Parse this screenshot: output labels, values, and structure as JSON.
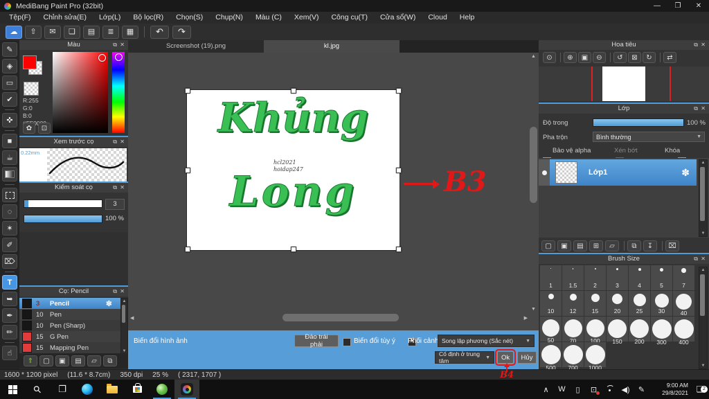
{
  "window": {
    "title": "MediBang Paint Pro (32bit)",
    "controls": {
      "minimize": "—",
      "maximize": "❐",
      "close": "✕"
    }
  },
  "menu": {
    "items": [
      "Tệp(F)",
      "Chỉnh sửa(E)",
      "Lớp(L)",
      "Bộ lọc(R)",
      "Chọn(S)",
      "Chụp(N)",
      "Màu (C)",
      "Xem(V)",
      "Công cụ(T)",
      "Cửa sổ(W)",
      "Cloud",
      "Help"
    ]
  },
  "toolbar": {
    "items": [
      {
        "name": "cloud-sync-icon",
        "glyph": "☁",
        "active": true
      },
      {
        "name": "export-icon",
        "glyph": "⇧"
      },
      {
        "name": "cloud-message-icon",
        "glyph": "✉"
      },
      {
        "name": "comment-icon",
        "glyph": "❏"
      },
      {
        "name": "document-icon",
        "glyph": "▤"
      },
      {
        "name": "material-list-icon",
        "glyph": "≣"
      },
      {
        "name": "panel-layout-icon",
        "glyph": "▦"
      }
    ],
    "history": [
      {
        "name": "undo-icon",
        "glyph": "↶"
      },
      {
        "name": "redo-icon",
        "glyph": "↷"
      }
    ]
  },
  "tools": {
    "items": [
      {
        "name": "tool-brush",
        "glyph": "✎"
      },
      {
        "name": "tool-eraser",
        "glyph": "◈"
      },
      {
        "name": "tool-shape",
        "glyph": "▭"
      },
      {
        "name": "tool-control-point",
        "glyph": "✔"
      },
      {
        "divider": true
      },
      {
        "name": "tool-move",
        "glyph": "✜"
      },
      {
        "divider": true
      },
      {
        "name": "tool-fill-rect",
        "glyph": "■"
      },
      {
        "name": "tool-bucket",
        "glyph": "☕"
      },
      {
        "name": "tool-gradient",
        "shape": "gradient"
      },
      {
        "divider": true
      },
      {
        "name": "tool-select",
        "shape": "dashed-box"
      },
      {
        "name": "tool-lasso",
        "glyph": "◌"
      },
      {
        "name": "tool-magic-wand",
        "glyph": "✶"
      },
      {
        "name": "tool-select-pen",
        "glyph": "✐"
      },
      {
        "name": "tool-select-eraser",
        "glyph": "⌦"
      },
      {
        "divider": true
      },
      {
        "name": "tool-text",
        "glyph": "T",
        "active": true
      },
      {
        "name": "tool-operation",
        "glyph": "➥"
      },
      {
        "name": "tool-eyedropper",
        "glyph": "✒"
      },
      {
        "name": "tool-measure",
        "glyph": "✏"
      },
      {
        "divider": true
      },
      {
        "name": "tool-hand",
        "glyph": "☝"
      }
    ]
  },
  "panel_icons": {
    "popout": "⧉",
    "close": "✕"
  },
  "color_panel": {
    "title": "Màu",
    "r": "R:255",
    "g": "G:0",
    "b": "B:0",
    "hex": "#FF0000",
    "fg_color": "#ff0000",
    "palette_button": "✿",
    "history_button": "⊡"
  },
  "brush_preview": {
    "title": "Xem trước cọ",
    "size_mm": "0.22mm"
  },
  "brush_control": {
    "title": "Kiểm soát cọ",
    "value": "3",
    "opacity": "100 %"
  },
  "brushes": {
    "title": "Cọ: Pencil",
    "gear": "✽",
    "items": [
      {
        "size": "3",
        "name": "Pencil",
        "selected": true,
        "swatch": "#161616"
      },
      {
        "size": "10",
        "name": "Pen",
        "swatch": "#161616"
      },
      {
        "size": "10",
        "name": "Pen (Sharp)",
        "swatch": "#161616"
      },
      {
        "size": "15",
        "name": "G Pen",
        "swatch": "#e23b3b"
      },
      {
        "size": "15",
        "name": "Mapping Pen",
        "swatch": "#e23b3b"
      }
    ],
    "actions": [
      {
        "name": "brush-download-icon",
        "glyph": "⇑",
        "color": "#8bc34a"
      },
      {
        "name": "new-brush-icon",
        "glyph": "▢"
      },
      {
        "name": "brush-from-image-icon",
        "glyph": "▣"
      },
      {
        "name": "brush-script-icon",
        "glyph": "▤"
      },
      {
        "name": "brush-folder-icon",
        "glyph": "▱"
      },
      {
        "name": "brush-duplicate-icon",
        "glyph": "⧉"
      }
    ]
  },
  "tabs": [
    {
      "label": "Screenshot (19).png",
      "active": false
    },
    {
      "label": "kl.jpg",
      "active": true
    }
  ],
  "canvas": {
    "word1": "Khủng",
    "word2": "Long",
    "watermark1": "hcl2021",
    "watermark2": "hoidap247",
    "annotation_b3": "B3",
    "annotation_b4": "B4",
    "text_color": "#3abf55",
    "annotation_color": "#e01818"
  },
  "navigator": {
    "title": "Hoa tiêu",
    "buttons": [
      {
        "name": "zoom-actual-icon",
        "glyph": "⊙"
      },
      {
        "divider": true
      },
      {
        "name": "zoom-in-icon",
        "glyph": "⊕"
      },
      {
        "name": "fit-screen-icon",
        "glyph": "▣"
      },
      {
        "name": "zoom-out-icon",
        "glyph": "⊖"
      },
      {
        "divider": true
      },
      {
        "name": "rotate-left-icon",
        "glyph": "↺"
      },
      {
        "name": "reset-rotation-icon",
        "glyph": "⊠"
      },
      {
        "name": "rotate-right-icon",
        "glyph": "↻"
      },
      {
        "divider": true
      },
      {
        "name": "flip-view-icon",
        "glyph": "⇄"
      }
    ]
  },
  "layer": {
    "title": "Lớp",
    "opacity_label": "Độ trong",
    "opacity_value": "100 %",
    "blend_label": "Pha trộn",
    "blend_value": "Bình thường",
    "cb_alpha": "Bảo vệ alpha",
    "cb_clip": "Xén bớt",
    "cb_lock": "Khóa",
    "layer_name": "Lớp1",
    "gear": "✽",
    "actions": [
      {
        "name": "new-layer-icon",
        "glyph": "▢"
      },
      {
        "name": "new-8bit-layer-icon",
        "glyph": "▣"
      },
      {
        "name": "new-1bit-layer-icon",
        "glyph": "▤"
      },
      {
        "name": "add-layer-icon",
        "glyph": "⊞"
      },
      {
        "name": "layer-folder-icon",
        "glyph": "▱"
      },
      {
        "divider": true
      },
      {
        "name": "duplicate-layer-icon",
        "glyph": "⧉"
      },
      {
        "name": "merge-layer-icon",
        "glyph": "↧"
      },
      {
        "divider": true
      },
      {
        "name": "delete-layer-icon",
        "glyph": "⌧"
      }
    ]
  },
  "brush_size": {
    "title": "Brush Size",
    "items": [
      {
        "label": "1",
        "dot": 1
      },
      {
        "label": "1.5",
        "dot": 1.5
      },
      {
        "label": "2",
        "dot": 2
      },
      {
        "label": "3",
        "dot": 3
      },
      {
        "label": "4",
        "dot": 4
      },
      {
        "label": "5",
        "dot": 5
      },
      {
        "label": "7",
        "dot": 6.5
      },
      {
        "label": "10",
        "dot": 8
      },
      {
        "label": "12",
        "dot": 10
      },
      {
        "label": "15",
        "dot": 12
      },
      {
        "label": "20",
        "dot": 15
      },
      {
        "label": "25",
        "dot": 18
      },
      {
        "label": "30",
        "dot": 20
      },
      {
        "label": "40",
        "dot": 23
      },
      {
        "label": "50",
        "dot": 25
      },
      {
        "label": "70",
        "dot": 26
      },
      {
        "label": "100",
        "dot": 26
      },
      {
        "label": "150",
        "dot": 27
      },
      {
        "label": "200",
        "dot": 27
      },
      {
        "label": "300",
        "dot": 28
      },
      {
        "label": "400",
        "dot": 28
      },
      {
        "label": "500",
        "dot": 28
      },
      {
        "label": "700",
        "dot": 28
      },
      {
        "label": "1000",
        "dot": 28
      }
    ]
  },
  "transform": {
    "label": "Biến đổi hình ảnh",
    "flip_button": "Đảo trái phải",
    "cb_free": "Biến đổi tùy ý",
    "cb_free_checked": false,
    "cb_perspective": "Phối cảnh",
    "cb_perspective_checked": true,
    "interpolation": "Song lập phương (Sắc nét)",
    "anchor": "Cố định ở trung tâm",
    "ok": "Ok",
    "cancel": "Hủy"
  },
  "status": {
    "size": "1600 * 1200 pixel",
    "cm": "(11.6 * 8.7cm)",
    "dpi": "350 dpi",
    "zoom": "25 %",
    "coords": "( 2317, 1707 )"
  },
  "taskbar": {
    "apps": [
      {
        "name": "start-button",
        "kind": "start"
      },
      {
        "name": "search-button",
        "kind": "search",
        "glyph": "⚲"
      },
      {
        "name": "task-view-button",
        "kind": "taskview",
        "glyph": "❐"
      },
      {
        "name": "edge-app",
        "kind": "edge"
      },
      {
        "name": "file-explorer-app",
        "kind": "explorer"
      },
      {
        "name": "store-app",
        "kind": "store"
      },
      {
        "name": "green-app",
        "kind": "greenapp",
        "running": true
      },
      {
        "name": "medibang-app",
        "kind": "medibang",
        "running": true,
        "active": true
      }
    ],
    "tray": [
      {
        "name": "tray-chevron-icon",
        "glyph": "∧"
      },
      {
        "name": "tray-w-icon",
        "glyph": "W"
      },
      {
        "name": "tray-battery-icon",
        "glyph": "▯"
      },
      {
        "name": "tray-display-icon",
        "glyph": "⊡",
        "red_dot": true
      },
      {
        "name": "tray-wifi-icon",
        "kind": "wifi"
      },
      {
        "name": "tray-volume-icon",
        "glyph": "◀)"
      },
      {
        "name": "tray-pen-icon",
        "glyph": "✎"
      }
    ],
    "time": "9:00 AM",
    "date": "29/8/2021",
    "notif_badge": "2"
  }
}
